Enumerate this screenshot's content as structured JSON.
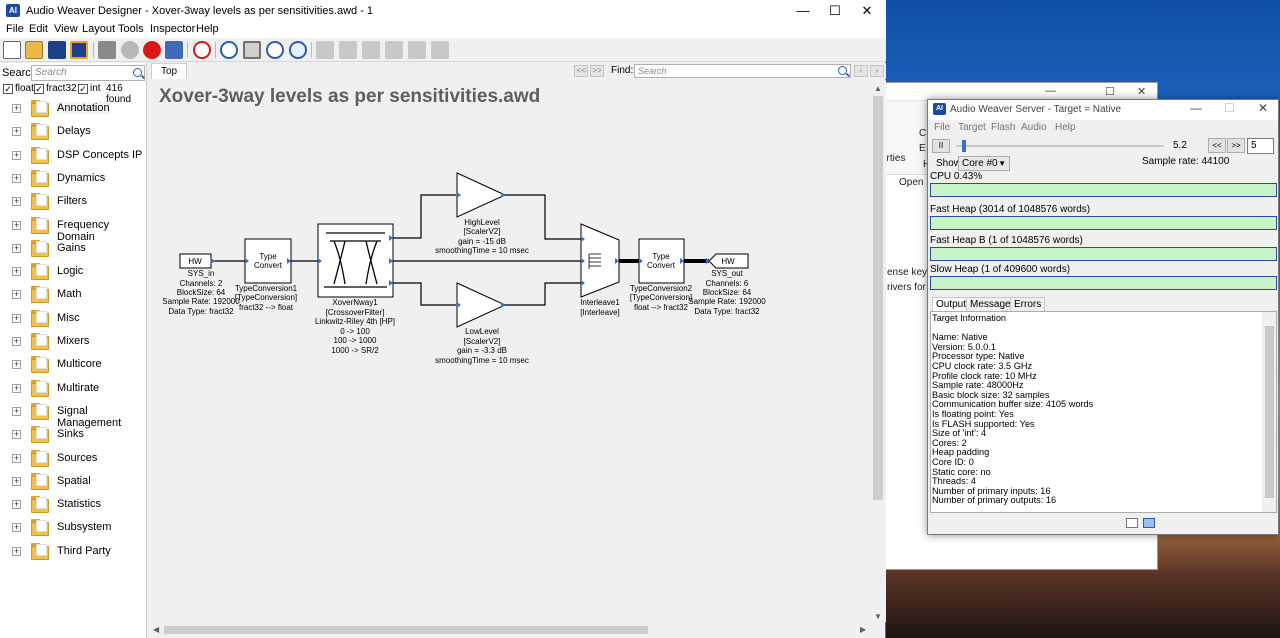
{
  "main_window": {
    "title": "Audio Weaver Designer - Xover-3way levels as per sensitivities.awd - 1",
    "icon_text": "AI",
    "controls": {
      "minimize": "—",
      "maximize": "☐",
      "close": "✕"
    }
  },
  "menu": [
    "File",
    "Edit",
    "View",
    "Layout",
    "Tools",
    "Inspector",
    "Help"
  ],
  "left_panel": {
    "search_label": "Search:",
    "search_placeholder": "Search",
    "filters": [
      {
        "label": "float",
        "checked": true
      },
      {
        "label": "fract32",
        "checked": true
      },
      {
        "label": "int",
        "checked": true
      }
    ],
    "found": "416 found",
    "tree": [
      "Annotation",
      "Delays",
      "DSP Concepts IP",
      "Dynamics",
      "Filters",
      "Frequency Domain",
      "Gains",
      "Logic",
      "Math",
      "Misc",
      "Mixers",
      "Multicore",
      "Multirate",
      "Signal Management",
      "Sinks",
      "Sources",
      "Spatial",
      "Statistics",
      "Subsystem",
      "Third Party"
    ]
  },
  "canvas": {
    "tab": "Top",
    "nav_prev": "<<",
    "nav_next": ">>",
    "find_label": "Find:",
    "find_placeholder": "Search",
    "design_title": "Xover-3way levels as per sensitivities.awd",
    "blocks": {
      "sys_in": {
        "box": "HW",
        "lines": [
          "SYS_in",
          "Channels: 2",
          "BlockSize: 64",
          "Sample Rate: 192000",
          "Data Type: fract32"
        ]
      },
      "type_conv1": {
        "box": [
          "Type",
          "Convert"
        ],
        "lines": [
          "TypeConversion1",
          "[TypeConversion]",
          "fract32 --> float"
        ]
      },
      "xover": {
        "lines": [
          "XoverNway1",
          "[CrossoverFilter]",
          "Linkwitz-Riley 4th [HP]",
          "0 -> 100",
          "100 -> 1000",
          "1000 -> SR/2"
        ]
      },
      "high_level": {
        "lines": [
          "HighLevel",
          "[ScalerV2]",
          "gain = -15 dB",
          "smoothingTime = 10 msec"
        ]
      },
      "low_level": {
        "lines": [
          "LowLevel",
          "[ScalerV2]",
          "gain = -3.3 dB",
          "smoothingTime = 10 msec"
        ]
      },
      "interleave": {
        "lines": [
          "Interleave1",
          "[Interleave]"
        ]
      },
      "type_conv2": {
        "box": [
          "Type",
          "Convert"
        ],
        "lines": [
          "TypeConversion2",
          "[TypeConversion]",
          "float --> fract32"
        ]
      },
      "sys_out": {
        "box": "HW",
        "lines": [
          "SYS_out",
          "Channels: 6",
          "BlockSize: 64",
          "Sample Rate: 192000",
          "Data Type: fract32"
        ]
      }
    }
  },
  "background_window": {
    "fragments": [
      "erties",
      "Open",
      "ense keys.",
      "rivers for W",
      "C",
      "E",
      "H"
    ]
  },
  "server": {
    "title": "Audio Weaver Server - Target = Native",
    "icon_text": "AI",
    "menu": [
      "File",
      "Target",
      "Flash",
      "Audio",
      "Help"
    ],
    "pause": "II",
    "slider_value": "5.2",
    "slider_fraction": 0.03,
    "prev_btn": "<<",
    "next_btn": ">>",
    "spin_value": "5",
    "show_label": "Show:",
    "core": "Core #0",
    "sample_rate": "Sample rate: 44100",
    "meters": [
      {
        "label": "CPU 0.43%"
      },
      {
        "label": "Fast Heap (3014 of 1048576 words)"
      },
      {
        "label": "Fast Heap B (1 of 1048576 words)"
      },
      {
        "label": "Slow Heap (1 of 409600 words)"
      }
    ],
    "tabs": [
      "Output",
      "Messages",
      "Errors"
    ],
    "output_lines": [
      "Target Information",
      "",
      "Name: Native",
      "Version: 5.0.0.1",
      "Processor type: Native",
      "CPU clock rate: 3.5 GHz",
      "Profile clock rate: 10 MHz",
      "Sample rate: 48000Hz",
      "Basic block size: 32 samples",
      "Communication buffer size: 4105 words",
      "Is floating point: Yes",
      "Is FLASH supported: Yes",
      "Size of 'int': 4",
      "Cores: 2",
      "Heap padding",
      "Core ID: 0",
      "Static core: no",
      "Threads: 4",
      "Number of primary inputs: 16",
      "Number of primary outputs: 16"
    ]
  }
}
